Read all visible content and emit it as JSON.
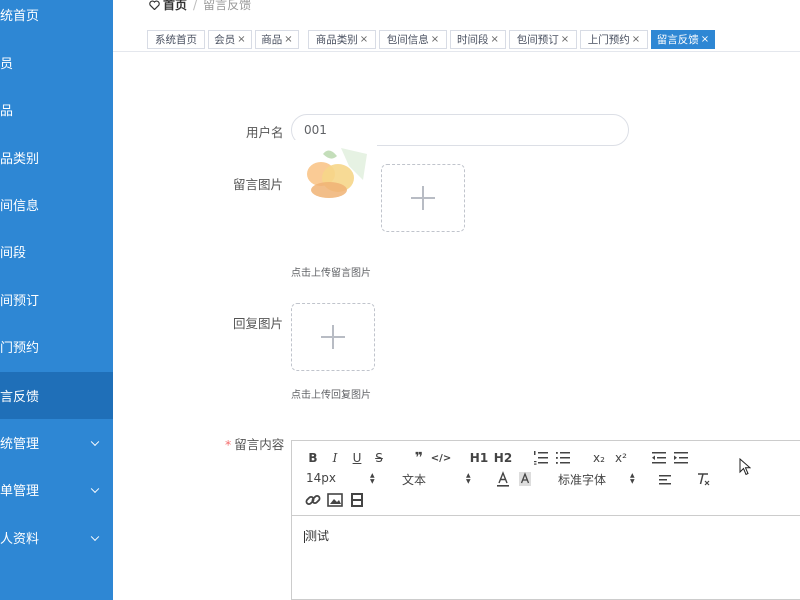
{
  "sidebar": {
    "items": [
      {
        "label": "统首页",
        "has_chevron": false
      },
      {
        "label": "员",
        "has_chevron": false
      },
      {
        "label": "品",
        "has_chevron": false
      },
      {
        "label": "品类别",
        "has_chevron": false
      },
      {
        "label": "间信息",
        "has_chevron": false
      },
      {
        "label": "间段",
        "has_chevron": false
      },
      {
        "label": "间预订",
        "has_chevron": false
      },
      {
        "label": "门预约",
        "has_chevron": false
      },
      {
        "label": "言反馈",
        "has_chevron": false,
        "active": true
      },
      {
        "label": "统管理",
        "has_chevron": true
      },
      {
        "label": "单管理",
        "has_chevron": true
      },
      {
        "label": "人资料",
        "has_chevron": true
      }
    ]
  },
  "header": {
    "home_label": "首页",
    "separator": "/",
    "current": "留言反馈"
  },
  "tabs": [
    {
      "label": "系统首页",
      "closable": false
    },
    {
      "label": "会员",
      "closable": true
    },
    {
      "label": "商品",
      "closable": true
    },
    {
      "label": "商品类别",
      "closable": true
    },
    {
      "label": "包间信息",
      "closable": true
    },
    {
      "label": "时间段",
      "closable": true
    },
    {
      "label": "包间预订",
      "closable": true
    },
    {
      "label": "上门预约",
      "closable": true
    },
    {
      "label": "留言反馈",
      "closable": true,
      "active": true
    }
  ],
  "tab_close_glyph": "×",
  "form": {
    "username_label": "用户名",
    "username_value": "001",
    "message_image_label": "留言图片",
    "message_image_hint": "点击上传留言图片",
    "reply_image_label": "回复图片",
    "reply_image_hint": "点击上传回复图片",
    "content_required_mark": "*",
    "content_label": "留言内容"
  },
  "editor": {
    "row1": [
      "B",
      "I",
      "U",
      "S",
      "❞",
      "</>",
      "H1",
      "H2",
      "ol",
      "ul",
      "x₂",
      "x²",
      "outdent",
      "indent"
    ],
    "font_size": "14px",
    "text_type": "文本",
    "font_family": "标准字体",
    "content": "测试"
  },
  "colors": {
    "sidebar_bg": "#2e87d4",
    "sidebar_active": "#1f6fb8",
    "accent": "#2e87d4",
    "required": "#f56c6c"
  }
}
